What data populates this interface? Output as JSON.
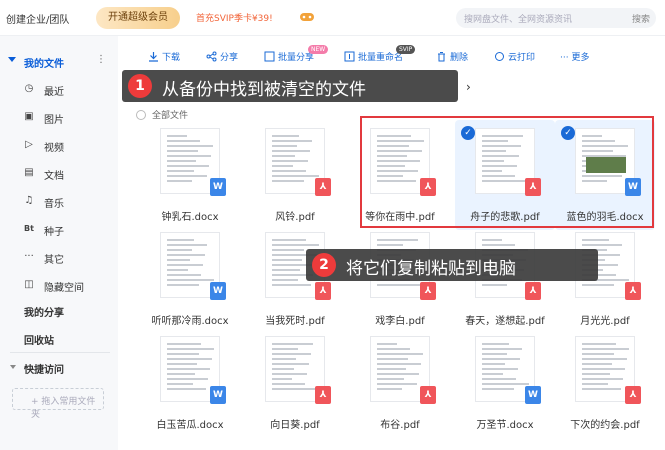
{
  "topbar": {
    "org_label": "创建企业/团队",
    "vip_label": "开通超级会员",
    "promo_text": "首充SVIP季卡¥39!",
    "search_placeholder": "搜网盘文件、全网资源资讯",
    "search_button": "搜索"
  },
  "sidebar": {
    "my_files": "我的文件",
    "items": [
      {
        "label": "最近",
        "icon": "clock-icon"
      },
      {
        "label": "图片",
        "icon": "image-icon"
      },
      {
        "label": "视频",
        "icon": "play-icon"
      },
      {
        "label": "文档",
        "icon": "document-icon"
      },
      {
        "label": "音乐",
        "icon": "music-icon"
      },
      {
        "label": "种子",
        "icon": "torrent-icon",
        "glyph": "Bt"
      },
      {
        "label": "其它",
        "icon": "more-icon"
      },
      {
        "label": "隐藏空间",
        "icon": "lock-icon"
      }
    ],
    "my_share": "我的分享",
    "recycle_bin": "回收站",
    "quick_access": "快捷访问",
    "drop_hint": "+ 拖入常用文件夹"
  },
  "toolbar": {
    "download": "下载",
    "share": "分享",
    "batch_share": "批量分享",
    "batch_rename": "批量重命名",
    "delete": "删除",
    "cloud_print": "云打印",
    "more": "更多",
    "new_badge": "NEW",
    "svip_badge": "SVIP"
  },
  "breadcrumb": {
    "all_files": "全部文件"
  },
  "files": [
    {
      "name": "钟乳石.docx",
      "type": "doc",
      "selected": false
    },
    {
      "name": "风铃.pdf",
      "type": "pdf",
      "selected": false
    },
    {
      "name": "等你在雨中.pdf",
      "type": "pdf",
      "selected": false
    },
    {
      "name": "舟子的悲歌.pdf",
      "type": "pdf",
      "selected": true
    },
    {
      "name": "蓝色的羽毛.docx",
      "type": "doc",
      "selected": true
    },
    {
      "name": "听听那冷雨.docx",
      "type": "doc",
      "selected": false
    },
    {
      "name": "当我死时.pdf",
      "type": "pdf",
      "selected": false
    },
    {
      "name": "戏李白.pdf",
      "type": "pdf",
      "selected": false
    },
    {
      "name": "春天，遂想起.pdf",
      "type": "pdf",
      "selected": false
    },
    {
      "name": "月光光.pdf",
      "type": "pdf",
      "selected": false
    },
    {
      "name": "白玉苦瓜.docx",
      "type": "doc",
      "selected": false
    },
    {
      "name": "向日葵.pdf",
      "type": "pdf",
      "selected": false
    },
    {
      "name": "布谷.pdf",
      "type": "pdf",
      "selected": false
    },
    {
      "name": "万圣节.docx",
      "type": "doc",
      "selected": false
    },
    {
      "name": "下次的约会.pdf",
      "type": "pdf",
      "selected": false
    }
  ],
  "callouts": [
    {
      "number": "1",
      "text": "从备份中找到被清空的文件"
    },
    {
      "number": "2",
      "text": "将它们复制粘贴到电脑"
    }
  ],
  "colors": {
    "accent": "#1a6ad6",
    "pdf": "#f0555a",
    "doc": "#3b86e8",
    "highlight": "#e2393e"
  }
}
